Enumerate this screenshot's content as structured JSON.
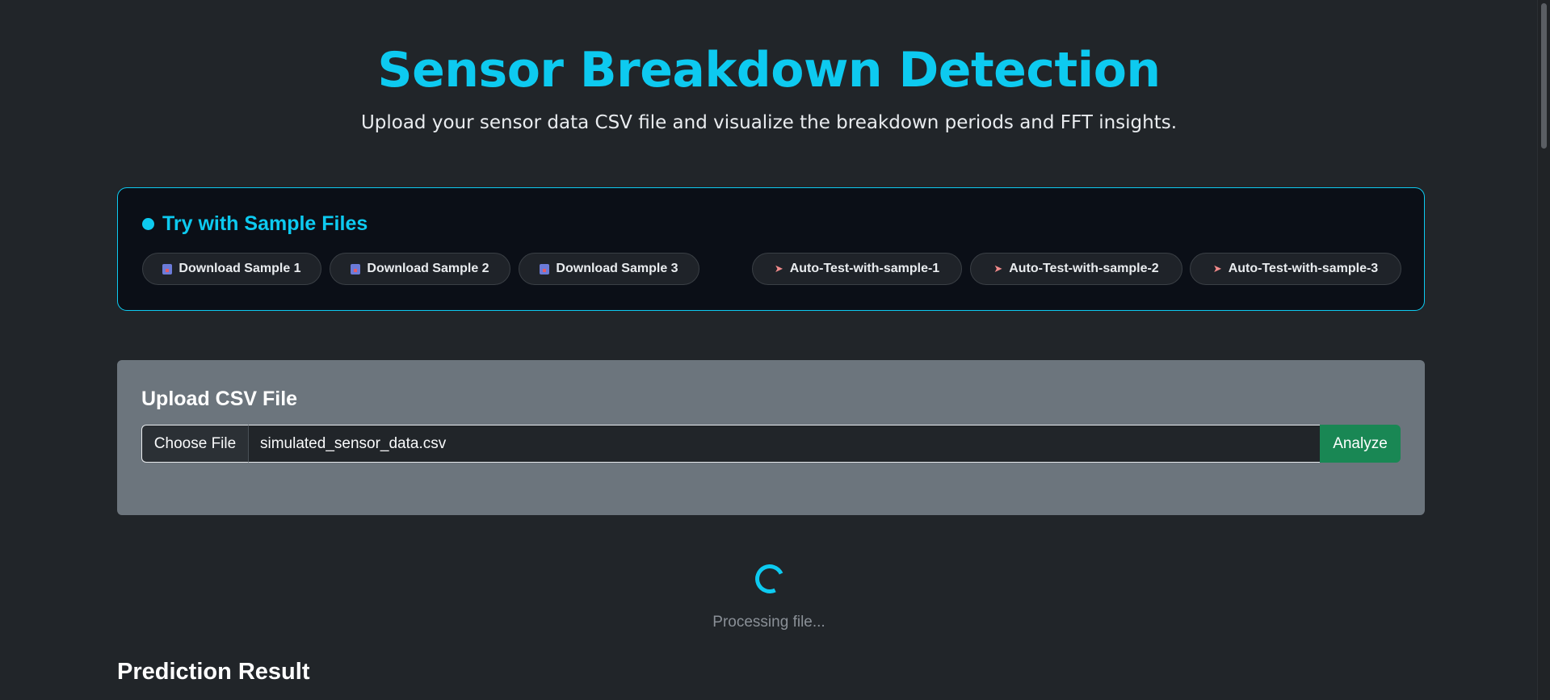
{
  "header": {
    "title": "Sensor Breakdown Detection",
    "subtitle": "Upload your sensor data CSV file and visualize the breakdown periods and FFT insights."
  },
  "samples": {
    "heading": "Try with Sample Files",
    "downloads": [
      {
        "label": "Download Sample 1",
        "icon": "download-box-icon"
      },
      {
        "label": "Download Sample 2",
        "icon": "download-box-icon"
      },
      {
        "label": "Download Sample 3",
        "icon": "download-box-icon"
      }
    ],
    "autotests": [
      {
        "label": "Auto-Test-with-sample-1",
        "icon": "rocket-icon"
      },
      {
        "label": "Auto-Test-with-sample-2",
        "icon": "rocket-icon"
      },
      {
        "label": "Auto-Test-with-sample-3",
        "icon": "rocket-icon"
      }
    ]
  },
  "upload": {
    "heading": "Upload CSV File",
    "choose_label": "Choose File",
    "file_name": "simulated_sensor_data.csv",
    "analyze_label": "Analyze"
  },
  "status": {
    "processing_text": "Processing file..."
  },
  "result": {
    "heading": "Prediction Result"
  },
  "colors": {
    "accent": "#0dcaf0",
    "background": "#212529",
    "analyze": "#198754",
    "upload_card": "#6c757d"
  }
}
